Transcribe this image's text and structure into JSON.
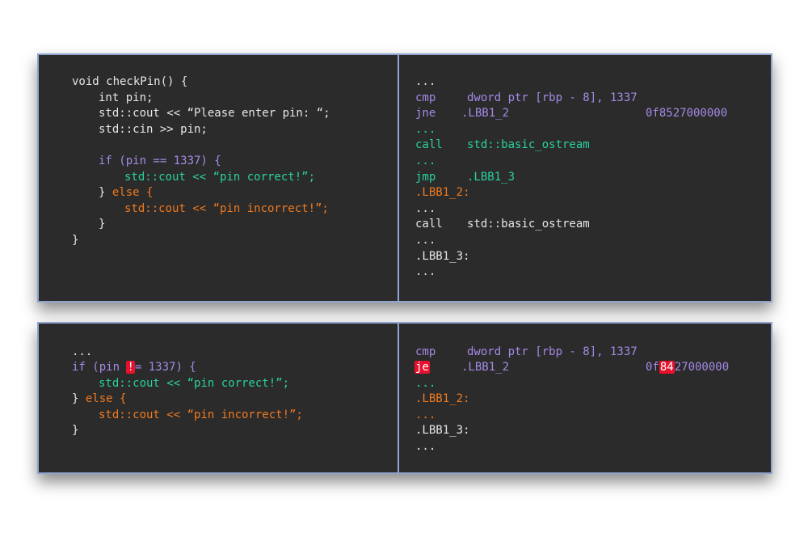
{
  "colors": {
    "background": "#2b2b2b",
    "border": "#8fa5cf",
    "purple": "#a48ae6",
    "green": "#2ad1a0",
    "orange": "#f07a20",
    "white": "#e6e6e6",
    "highlight": "#e8112d"
  },
  "top_left": {
    "l1": "void checkPin() {",
    "l2": "int pin;",
    "l3": "std::cout << “Please enter pin: “;",
    "l4": "std::cin >> pin;",
    "l5": "if (pin == 1337) {",
    "l6": "std::cout << “pin correct!”;",
    "l7a": "} ",
    "l7b": "else {",
    "l8": "std::cout << “pin incorrect!”;",
    "l9": "}",
    "l10": "}"
  },
  "top_right": {
    "l1": "...",
    "l2_op": "cmp",
    "l2_arg": "dword ptr [rbp - 8], 1337",
    "l3_op": "jne",
    "l3_arg": ".LBB1_2",
    "l3_hex": "0f8527000000",
    "l4": "...",
    "l5_op": "call",
    "l5_arg": "std::basic_ostream",
    "l6": "...",
    "l7_op": "jmp",
    "l7_arg": ".LBB1_3",
    "l8": ".LBB1_2:",
    "l9": "...",
    "l10_op": "call",
    "l10_arg": "std::basic_ostream",
    "l11": "...",
    "l12": ".LBB1_3:",
    "l13": "..."
  },
  "bottom_left": {
    "l1": "...",
    "l2_pre": "if (pin ",
    "l2_hl": "!",
    "l2_post": "= 1337) {",
    "l3": "std::cout << “pin correct!”;",
    "l4a": "} ",
    "l4b": "else {",
    "l5": "std::cout << “pin incorrect!”;",
    "l6": "}"
  },
  "bottom_right": {
    "l1_op": "cmp",
    "l1_arg": "dword ptr [rbp - 8], 1337",
    "l2_op": "je",
    "l2_arg": ".LBB1_2",
    "l2_hex_pre": "0f",
    "l2_hex_hl": "84",
    "l2_hex_post": "27000000",
    "l3": "...",
    "l4": ".LBB1_2:",
    "l5": "...",
    "l6": ".LBB1_3:",
    "l7": "..."
  }
}
